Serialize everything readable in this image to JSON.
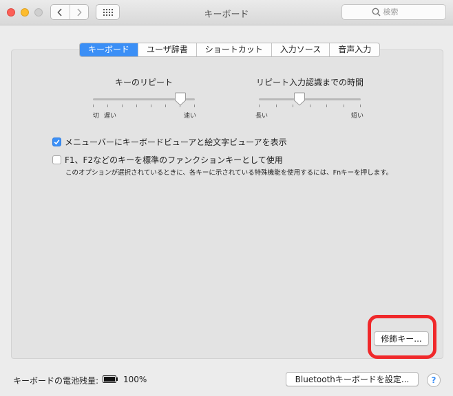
{
  "window": {
    "title": "キーボード"
  },
  "search": {
    "placeholder": "検索"
  },
  "tabs": [
    {
      "label": "キーボード",
      "selected": true
    },
    {
      "label": "ユーザ辞書",
      "selected": false
    },
    {
      "label": "ショートカット",
      "selected": false
    },
    {
      "label": "入力ソース",
      "selected": false
    },
    {
      "label": "音声入力",
      "selected": false
    }
  ],
  "key_repeat": {
    "title": "キーのリピート",
    "label_off": "切",
    "label_slow": "遅い",
    "label_fast": "速い",
    "value_fraction": 0.86
  },
  "repeat_delay": {
    "title": "リピート入力認識までの時間",
    "label_long": "長い",
    "label_short": "短い",
    "value_fraction": 0.4
  },
  "options": {
    "show_viewer": {
      "label": "メニューバーにキーボードビューアと絵文字ビューアを表示",
      "checked": true
    },
    "fn_keys": {
      "label": "F1、F2などのキーを標準のファンクションキーとして使用",
      "checked": false,
      "description": "このオプションが選択されているときに、各キーに示されている特殊機能を使用するには、Fnキーを押します。"
    }
  },
  "buttons": {
    "modifier_keys": "修飾キー...",
    "bluetooth_setup": "Bluetoothキーボードを設定...",
    "help": "?"
  },
  "battery": {
    "label": "キーボードの電池残量:",
    "percent": "100%"
  },
  "colors": {
    "accent": "#3b8ff6",
    "highlight": "#f0282a"
  },
  "icons": [
    "back-chevron-icon",
    "forward-chevron-icon",
    "grid-icon",
    "search-icon",
    "checkmark-icon",
    "battery-icon",
    "help-icon"
  ]
}
